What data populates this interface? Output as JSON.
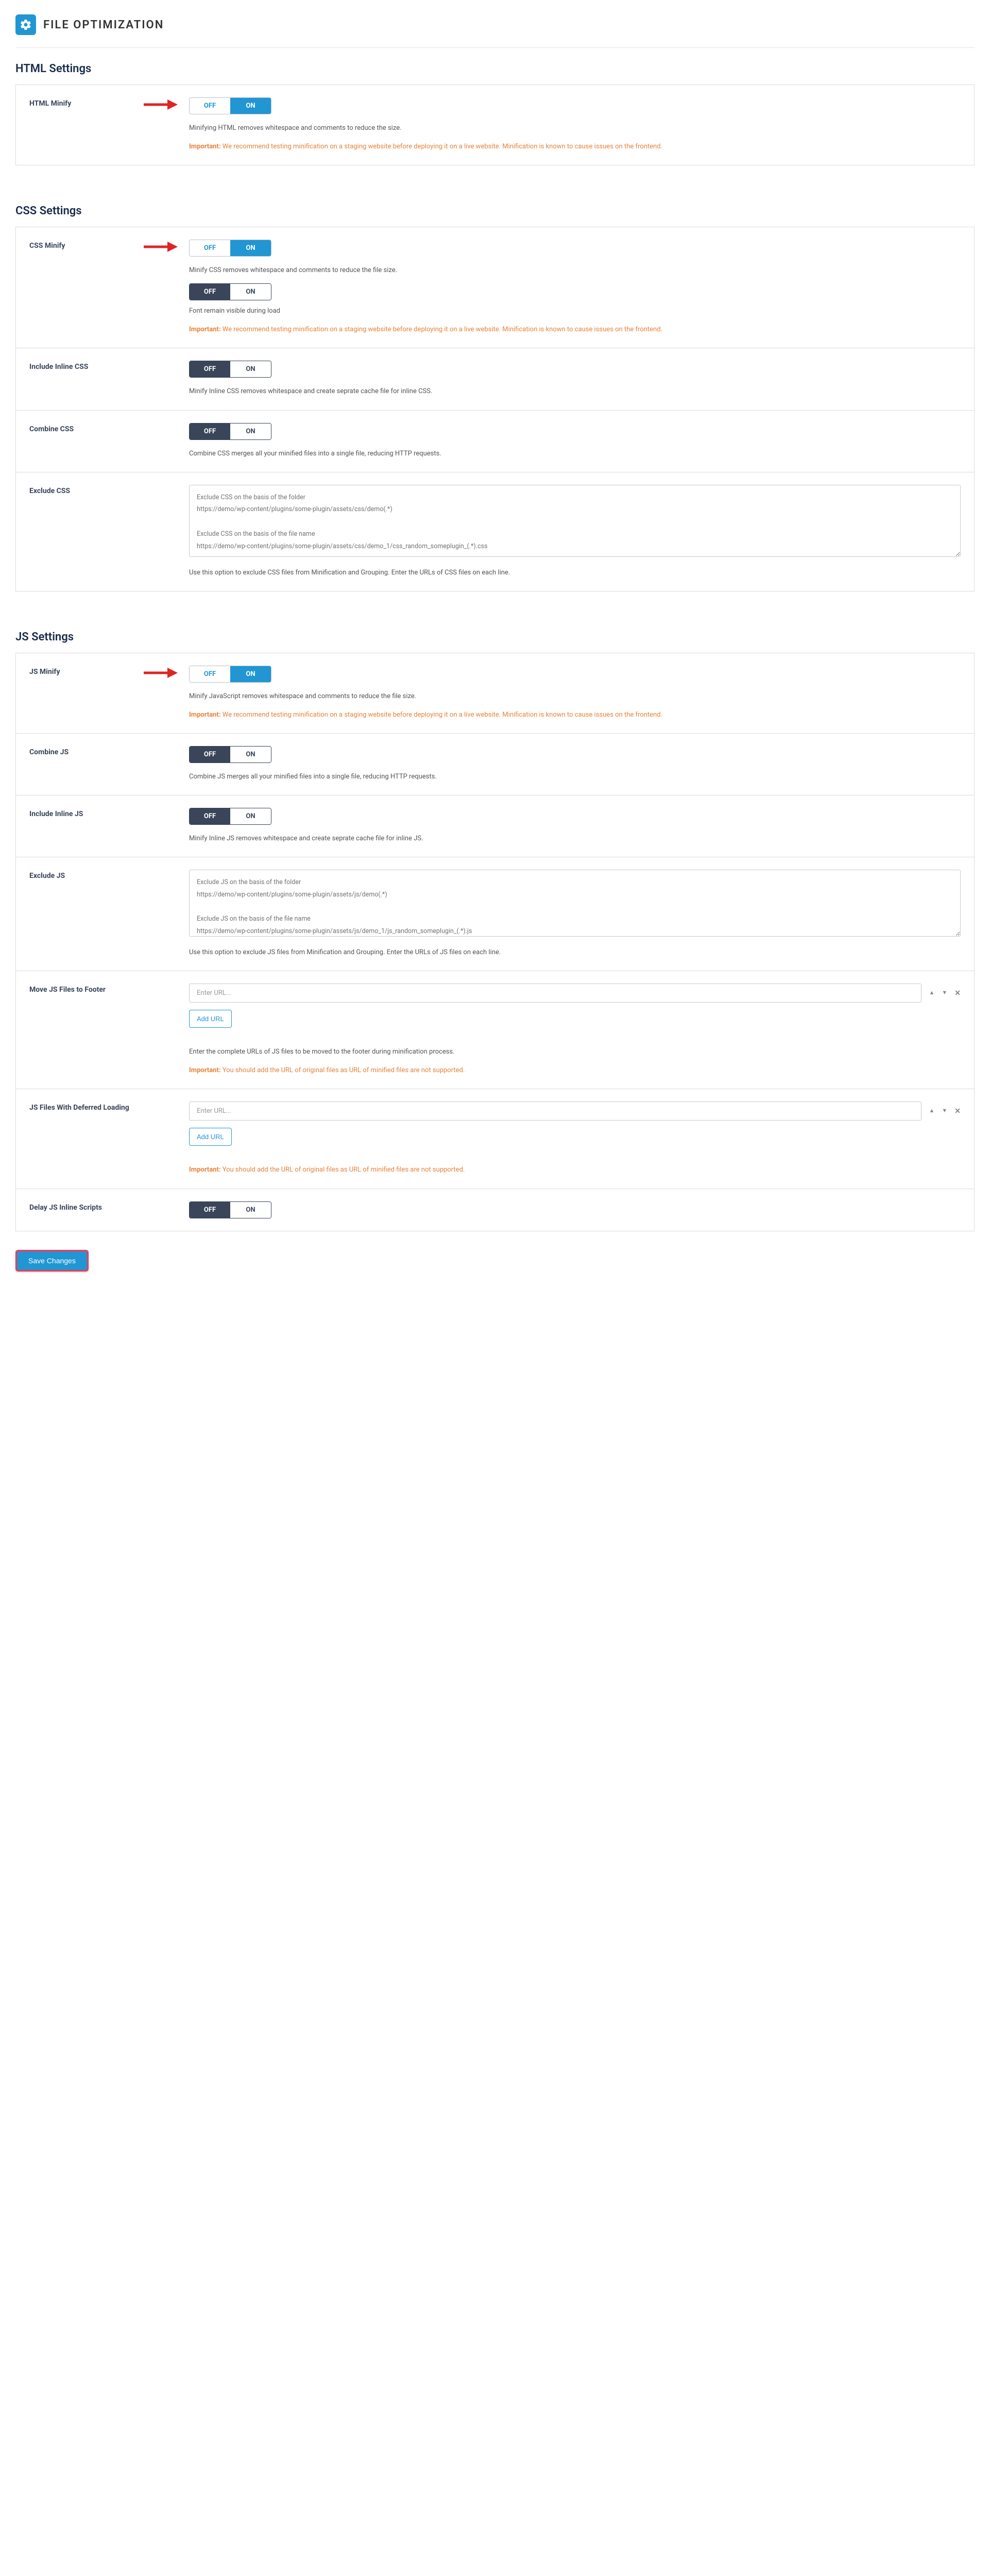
{
  "page_title": "FILE OPTIMIZATION",
  "heading_html": "HTML Settings",
  "heading_css": "CSS Settings",
  "heading_js": "JS Settings",
  "important": "Important:",
  "warn_staging": "We recommend testing minification on a staging website before deploying it on a live website. Minification is known to cause issues on the frontend.",
  "warn_original": "You should add the URL of original files as URL of minified files are not supported.",
  "toggle_off": "OFF",
  "toggle_on": "ON",
  "html_minify": {
    "label": "HTML Minify",
    "desc": "Minifying HTML removes whitespace and comments to reduce the size."
  },
  "css_minify": {
    "label": "CSS Minify",
    "desc": "Minify CSS removes whitespace and comments to reduce the file size.",
    "font_desc": "Font remain visible during load"
  },
  "include_inline_css": {
    "label": "Include Inline CSS",
    "desc": "Minify Inline CSS removes whitespace and create seprate cache file for inline CSS."
  },
  "combine_css": {
    "label": "Combine CSS",
    "desc": "Combine CSS merges all your minified files into a single file, reducing HTTP requests."
  },
  "exclude_css": {
    "label": "Exclude CSS",
    "placeholder": "Exclude CSS on the basis of the folder\nhttps://demo/wp-content/plugins/some-plugin/assets/css/demo(.*)\n\nExclude CSS on the basis of the file name\nhttps://demo/wp-content/plugins/some-plugin/assets/css/demo_1/css_random_someplugin_(.*).css",
    "desc": "Use this option to exclude CSS files from Minification and Grouping. Enter the URLs of CSS files on each line."
  },
  "js_minify": {
    "label": "JS Minify",
    "desc": "Minify JavaScript removes whitespace and comments to reduce the file size."
  },
  "combine_js": {
    "label": "Combine JS",
    "desc": "Combine JS merges all your minified files into a single file, reducing HTTP requests."
  },
  "include_inline_js": {
    "label": "Include Inline JS",
    "desc": "Minify Inline JS removes whitespace and create seprate cache file for inline JS."
  },
  "exclude_js": {
    "label": "Exclude JS",
    "placeholder": "Exclude JS on the basis of the folder\nhttps://demo/wp-content/plugins/some-plugin/assets/js/demo(.*)\n\nExclude JS on the basis of the file name\nhttps://demo/wp-content/plugins/some-plugin/assets/js/demo_1/js_random_someplugin_(.*).js",
    "desc": "Use this option to exclude JS files from Minification and Grouping. Enter the URLs of JS files on each line."
  },
  "move_footer": {
    "label": "Move JS Files to Footer",
    "placeholder": "Enter URL...",
    "add": "Add URL",
    "desc": "Enter the complete URLs of JS files to be moved to the footer during minification process."
  },
  "deferred": {
    "label": "JS Files With Deferred Loading",
    "placeholder": "Enter URL...",
    "add": "Add URL"
  },
  "delay_inline": {
    "label": "Delay JS Inline Scripts"
  },
  "save": "Save Changes"
}
